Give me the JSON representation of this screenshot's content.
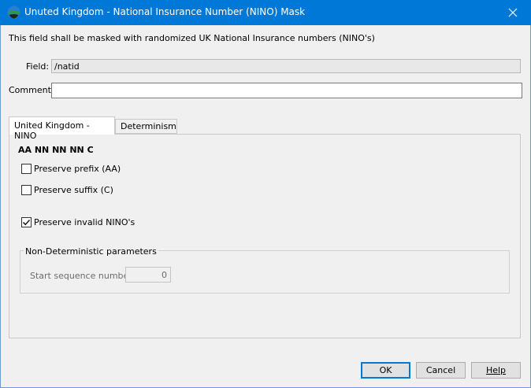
{
  "window": {
    "title": "Unuted Kingdom - National Insurance Number (NINO) Mask",
    "title_color": "#0078d7",
    "app_icon": "globe-icon",
    "close_icon": "close-icon"
  },
  "description": "This field shall be masked with randomized UK National Insurance numbers (NINO's)",
  "field": {
    "label": "Field:",
    "value": "/natid"
  },
  "comment": {
    "label": "Comment:",
    "value": ""
  },
  "tabs": [
    {
      "label": "United Kingdom - NINO",
      "active": true
    },
    {
      "label": "Determinism",
      "active": false
    }
  ],
  "nino_tab": {
    "format": "AA NN NN NN C",
    "options": [
      {
        "label": "Preserve prefix (AA)",
        "checked": false
      },
      {
        "label": "Preserve suffix (C)",
        "checked": false
      },
      {
        "label": "Preserve invalid NINO's",
        "checked": true
      }
    ],
    "group": {
      "title": "Non-Deterministic parameters",
      "start_label": "Start sequence number:",
      "start_value": "0"
    }
  },
  "buttons": {
    "ok": "OK",
    "cancel": "Cancel",
    "help": "Help"
  }
}
